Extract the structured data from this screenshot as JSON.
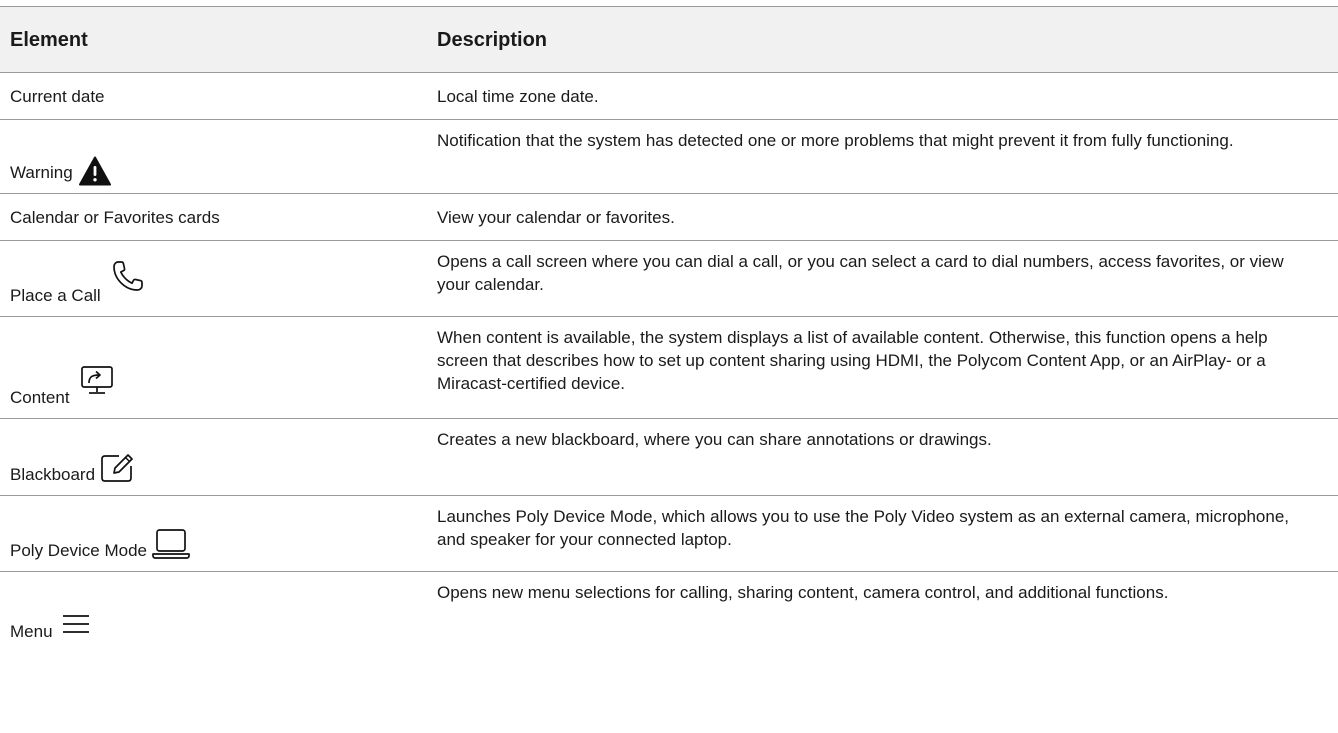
{
  "table": {
    "headers": {
      "element": "Element",
      "description": "Description"
    },
    "rows": [
      {
        "element": "Current date",
        "icon": "",
        "description": "Local time zone date."
      },
      {
        "element": "Warning",
        "icon": "warning-icon",
        "description": "Notification that the system has detected one or more problems that might prevent it from fully functioning."
      },
      {
        "element": "Calendar or Favorites cards",
        "icon": "",
        "description": "View your calendar or favorites."
      },
      {
        "element": "Place a Call",
        "icon": "phone-icon",
        "description": "Opens a call screen where you can dial a call, or you can select a card to dial numbers, access favorites, or view your calendar."
      },
      {
        "element": "Content",
        "icon": "content-share-icon",
        "description": "When content is available, the system displays a list of available content. Otherwise, this function opens a help screen that describes how to set up content sharing using HDMI, the Polycom Content App, or an AirPlay- or a Miracast-certified device."
      },
      {
        "element": "Blackboard",
        "icon": "blackboard-icon",
        "description": "Creates a new blackboard, where you can share annotations or drawings."
      },
      {
        "element": "Poly Device Mode",
        "icon": "laptop-icon",
        "description": "Launches Poly Device Mode, which allows you to use the Poly Video system as an external camera, microphone, and speaker for your connected laptop."
      },
      {
        "element": "Menu",
        "icon": "menu-icon",
        "description": "Opens new menu selections for calling, sharing content, camera control, and additional functions."
      }
    ]
  }
}
